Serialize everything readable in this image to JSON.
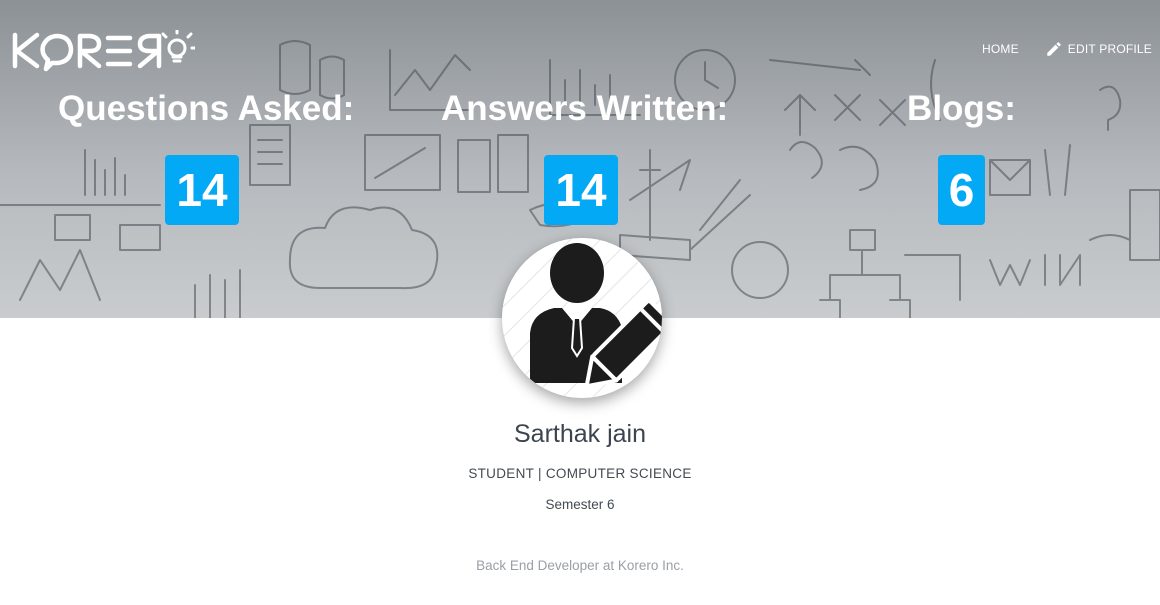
{
  "brand": {
    "logo_text": "KORERO",
    "logo_icon": "lightbulb-icon"
  },
  "nav": {
    "home_label": "HOME",
    "edit_profile_label": "EDIT PROFILE",
    "edit_icon": "pencil-icon"
  },
  "stats": [
    {
      "title": "Questions Asked:",
      "value": "14"
    },
    {
      "title": "Answers Written:",
      "value": "14"
    },
    {
      "title": "Blogs:",
      "value": "6"
    }
  ],
  "profile": {
    "avatar_icon": "person-with-pencil-icon",
    "name": "Sarthak jain",
    "role": "STUDENT | COMPUTER SCIENCE",
    "semester": "Semester 6",
    "job": "Back End Developer at Korero Inc."
  },
  "colors": {
    "accent": "#03a9f4",
    "hero_bg": "#a9adb1",
    "name_text": "#3c4450"
  }
}
